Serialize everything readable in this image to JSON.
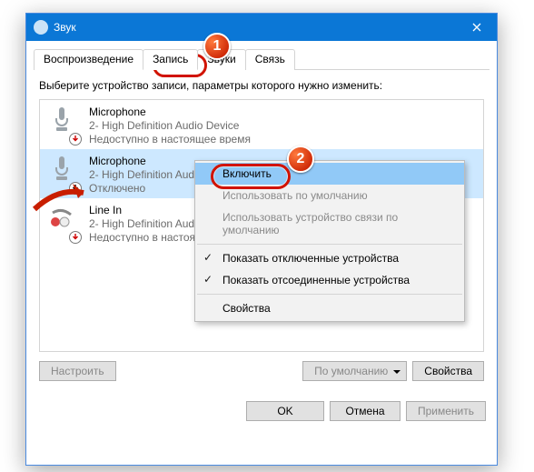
{
  "window": {
    "title": "Звук"
  },
  "tabs": [
    "Воспроизведение",
    "Запись",
    "Звуки",
    "Связь"
  ],
  "active_tab_index": 1,
  "instruction": "Выберите устройство записи, параметры которого нужно изменить:",
  "devices": [
    {
      "name": "Microphone",
      "sub": "2- High Definition Audio Device",
      "status": "Недоступно в настоящее время",
      "badge": "down"
    },
    {
      "name": "Microphone",
      "sub": "2- High Definition Audio Device",
      "status": "Отключено",
      "badge": "down",
      "selected": true
    },
    {
      "name": "Line In",
      "sub": "2- High Definition Audio Device",
      "status": "Недоступно в настоящее время",
      "badge": "down"
    }
  ],
  "buttons": {
    "configure": "Настроить",
    "default": "По умолчанию",
    "properties": "Свойства",
    "ok": "OK",
    "cancel": "Отмена",
    "apply": "Применить"
  },
  "context_menu": {
    "enable": "Включить",
    "use_default": "Использовать по умолчанию",
    "use_comm_default": "Использовать устройство связи по умолчанию",
    "show_disabled": "Показать отключенные устройства",
    "show_disconnected": "Показать отсоединенные устройства",
    "properties": "Свойства"
  },
  "callouts": {
    "1": "1",
    "2": "2"
  }
}
